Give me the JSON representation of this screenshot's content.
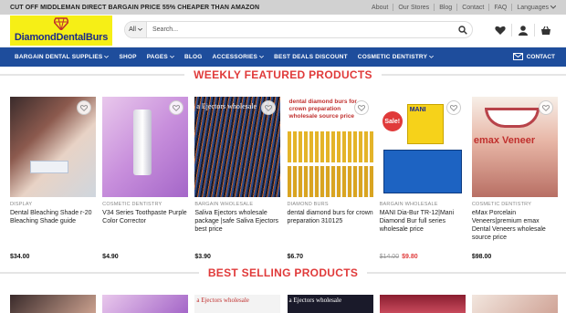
{
  "topbar": {
    "promo": "CUT OFF MIDDLEMAN DIRECT BARGAIN PRICE 55% CHEAPER THAN AMAZON",
    "links": [
      "About",
      "Our Stores",
      "Blog",
      "Contact",
      "FAQ"
    ],
    "language": "Languages"
  },
  "logo": {
    "part1": "Diamond",
    "part2": "DentalBurs"
  },
  "search": {
    "category": "All",
    "placeholder": "Search..."
  },
  "nav": {
    "items": [
      "BARGAIN DENTAL SUPPLIES",
      "SHOP",
      "PAGES",
      "BLOG",
      "ACCESSORIES",
      "BEST DEALS DISCOUNT",
      "COSMETIC DENTISTRY"
    ],
    "contact": "CONTACT"
  },
  "sections": {
    "featured": "WEEKLY FEATURED PRODUCTS",
    "bestselling": "BEST SELLING PRODUCTS"
  },
  "products": [
    {
      "category": "DISPLAY",
      "name": "Dental Bleaching Shade r-20 Bleaching Shade guide",
      "price": "$34.00"
    },
    {
      "category": "COSMETIC DENTISTRY",
      "name": "V34 Series Toothpaste Purple Color Corrector",
      "price": "$4.90"
    },
    {
      "category": "BARGAIN WHOLESALE",
      "name": "Saliva Ejectors wholesale package |safe Saliva Ejectors best price",
      "price": "$3.90",
      "image_text": "a Ejectors wholesale"
    },
    {
      "category": "DIAMOND BURS",
      "name": "dental diamond burs for crown preparation 310125",
      "price": "$6.70",
      "image_text": "dental diamond burs for crown preparation wholesale source price"
    },
    {
      "category": "BARGAIN WHOLESALE",
      "name": "MANI Dia-Bur TR-12|Mani Diamond Bur full series wholesale price",
      "old_price": "$14.00",
      "price": "$9.80",
      "badge": "Sale!",
      "image_text": "MANI"
    },
    {
      "category": "COSMETIC DENTISTRY",
      "name": "eMax Porcelain Veneers|premium emax Dental Veneers wholesale source price",
      "price": "$98.00",
      "image_text": "emax Veneer"
    }
  ],
  "bestselling_images": [
    "",
    "",
    "a Ejectors wholesale",
    "a Ejectors wholesale",
    "",
    ""
  ],
  "colors": {
    "accent": "#e03a3a",
    "nav": "#1e4d9c",
    "logo_bg": "#f6ef16"
  },
  "icons": [
    "chevron-down-icon",
    "search-icon",
    "heart-icon",
    "user-icon",
    "cart-icon",
    "mail-icon"
  ]
}
